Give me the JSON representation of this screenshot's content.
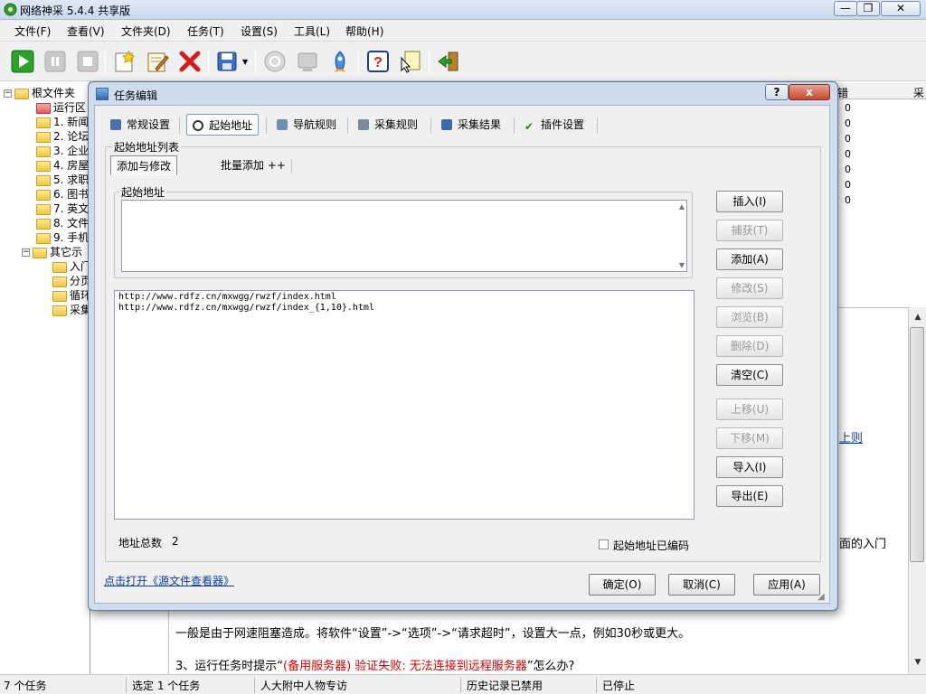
{
  "app": {
    "title": "网络神采 5.4.4 共享版"
  },
  "menu": [
    "文件(F)",
    "查看(V)",
    "文件夹(D)",
    "任务(T)",
    "设置(S)",
    "工具(L)",
    "帮助(H)"
  ],
  "tree": {
    "root": "根文件夹",
    "items": [
      "运行区",
      "1. 新闻",
      "2. 论坛",
      "3. 企业",
      "4. 房屋",
      "5. 求职",
      "6. 图书",
      "7. 英文",
      "8. 文件",
      "9. 手机",
      "其它示",
      "入门",
      "分页",
      "循环",
      "采集"
    ]
  },
  "list": {
    "col_error": "错",
    "col_collect": "采",
    "zeros": [
      "0",
      "0",
      "0",
      "0",
      "0",
      "0",
      "0"
    ]
  },
  "help": {
    "fragment_rule": "上则",
    "fragment_entry": "面的入门",
    "line1": "一般是由于网速阻塞造成。将软件“设置”->“选项”->“请求超时”，设置大一点，例如30秒或更大。",
    "line2_prefix": "3、运行任务时提示“",
    "line2_red": "(备用服务器) 验证失败: 无法连接到远程服务器",
    "line2_suffix": "”怎么办?"
  },
  "status": [
    "7 个任务",
    "选定 1 个任务",
    "人大附中人物专访",
    "历史记录已禁用",
    "已停止"
  ],
  "dialog": {
    "title": "任务编辑",
    "help_button": "?",
    "close_button": "x",
    "tabs": [
      "常规设置",
      "起始地址",
      "导航规则",
      "采集规则",
      "采集结果",
      "插件设置"
    ],
    "active_tab": "起始地址",
    "group_title": "起始地址列表",
    "subtabs": [
      "添加与修改",
      "批量添加 ++"
    ],
    "input_group": "起始地址",
    "urls": [
      "http://www.rdfz.cn/mxwgg/rwzf/index.html",
      "http://www.rdfz.cn/mxwgg/rwzf/index_{1,10}.html"
    ],
    "count_label": "地址总数",
    "count_value": "2",
    "encoded_label": "起始地址已编码",
    "source_link": "点击打开《源文件查看器》",
    "side_buttons": [
      {
        "label": "插入(I)",
        "enabled": true
      },
      {
        "label": "捕获(T)",
        "enabled": false
      },
      {
        "label": "添加(A)",
        "enabled": true
      },
      {
        "label": "修改(S)",
        "enabled": false
      },
      {
        "label": "浏览(B)",
        "enabled": false
      },
      {
        "label": "删除(D)",
        "enabled": false
      },
      {
        "label": "清空(C)",
        "enabled": true
      },
      {
        "label": "上移(U)",
        "enabled": false
      },
      {
        "label": "下移(M)",
        "enabled": false
      },
      {
        "label": "导入(I)",
        "enabled": true
      },
      {
        "label": "导出(E)",
        "enabled": true
      }
    ],
    "ok_button": "确定(O)",
    "cancel_button": "取消(C)",
    "apply_button": "应用(A)"
  }
}
